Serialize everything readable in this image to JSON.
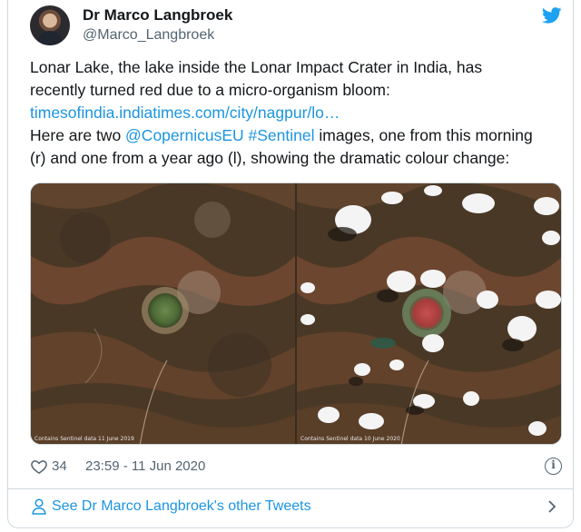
{
  "tweet": {
    "author_name": "Dr Marco Langbroek",
    "author_handle": "@Marco_Langbroek",
    "text": {
      "line1": "Lonar Lake, the lake inside the Lonar Impact Crater in India, has",
      "line2": "recently turned red due to a micro-organism bloom:",
      "link": "timesofindia.indiatimes.com/city/nagpur/lo…",
      "line4_pre": "Here are two ",
      "mention": "@CopernicusEU",
      "hashtag": "#Sentinel",
      "line4_post": " images, one from this morning",
      "line5": "(r) and one from a year ago (l), showing the dramatic colour change:"
    },
    "images": {
      "left_stamp": "Contains Sentinel data   11 June 2019",
      "right_stamp": "Contains Sentinel data   10 June 2020"
    },
    "likes": "34",
    "timestamp": "23:59 - 11 Jun 2020"
  },
  "footer": {
    "more_tweets": "See Dr Marco Langbroek's other Tweets"
  },
  "icons": {
    "brand": "twitter-bird-icon",
    "like": "heart-icon",
    "info": "info-icon",
    "profile": "person-icon",
    "chevron": "chevron-right-icon"
  },
  "colors": {
    "link": "#1b95e0",
    "text": "#14171a",
    "secondary": "#536471",
    "border": "#cfd9de"
  }
}
